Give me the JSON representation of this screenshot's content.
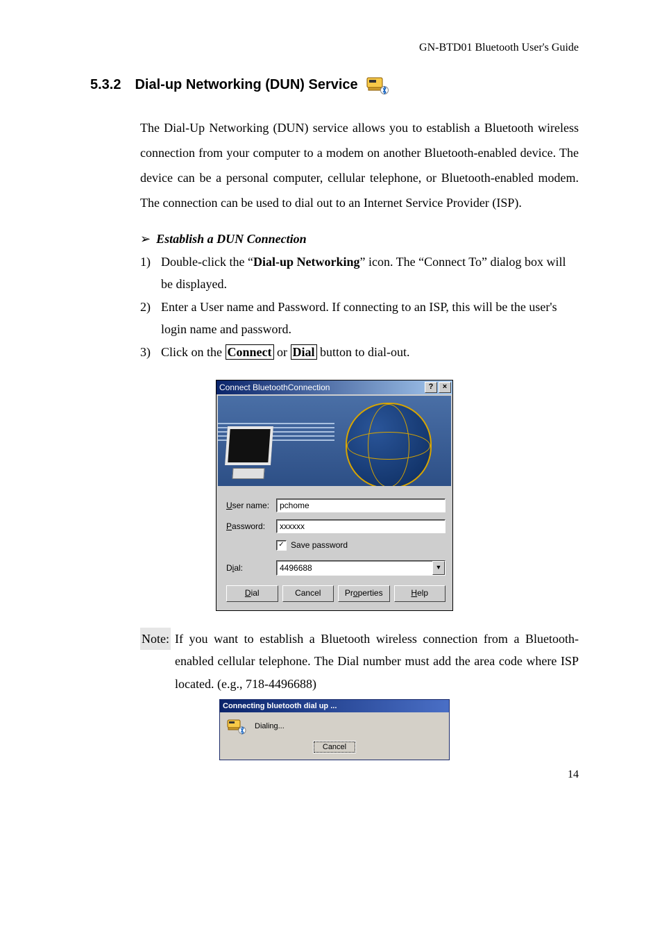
{
  "running_header": "GN-BTD01 Bluetooth User's Guide",
  "section": {
    "number": "5.3.2",
    "title": "Dial-up Networking (DUN) Service"
  },
  "intro_paragraph": "The Dial-Up Networking (DUN) service allows you to establish a Bluetooth wireless connection from your computer to a modem on another Bluetooth-enabled device. The device can be a personal computer, cellular telephone, or Bluetooth-enabled modem. The connection can be used to dial out to an Internet Service Provider (ISP).",
  "subheading": "Establish a DUN Connection",
  "steps": [
    {
      "num": "1)",
      "pre": "Double-click the “",
      "bold": "Dial-up Networking",
      "post": "” icon. The “Connect To” dialog box will be displayed."
    },
    {
      "num": "2)",
      "text": "Enter a User name and Password. If connecting to an ISP, this will be the user's login name and password."
    },
    {
      "num": "3)",
      "pre": "Click on the ",
      "box1": "Connect",
      "mid": " or ",
      "box2": "Dial",
      "post": " button to dial-out."
    }
  ],
  "connect_dialog": {
    "title": "Connect BluetoothConnection",
    "help_btn": "?",
    "close_btn": "×",
    "user_label_u": "U",
    "user_label_rest": "ser name:",
    "user_value": "pchome",
    "pass_label_p": "P",
    "pass_label_rest": "assword:",
    "pass_value": "xxxxxx",
    "save_checked": "✓",
    "save_s": "S",
    "save_rest": "ave password",
    "dial_label_i": "i",
    "dial_label_pre": "D",
    "dial_label_post": "al:",
    "dial_value": "4496688",
    "combo_arrow": "▼",
    "btn_dial_d": "D",
    "btn_dial_rest": "ial",
    "btn_cancel": "Cancel",
    "btn_props_o": "o",
    "btn_props_pre": "Pr",
    "btn_props_post": "perties",
    "btn_help_h": "H",
    "btn_help_rest": "elp"
  },
  "note": {
    "label": "Note:",
    "text": "If you want to establish a Bluetooth wireless connection from a Bluetooth-enabled cellular telephone. The Dial number must add the area code where ISP located. (e.g., 718-4496688)"
  },
  "progress_dialog": {
    "title": "Connecting bluetooth dial up ...",
    "status": "Dialing...",
    "cancel": "Cancel"
  },
  "page_number": "14"
}
